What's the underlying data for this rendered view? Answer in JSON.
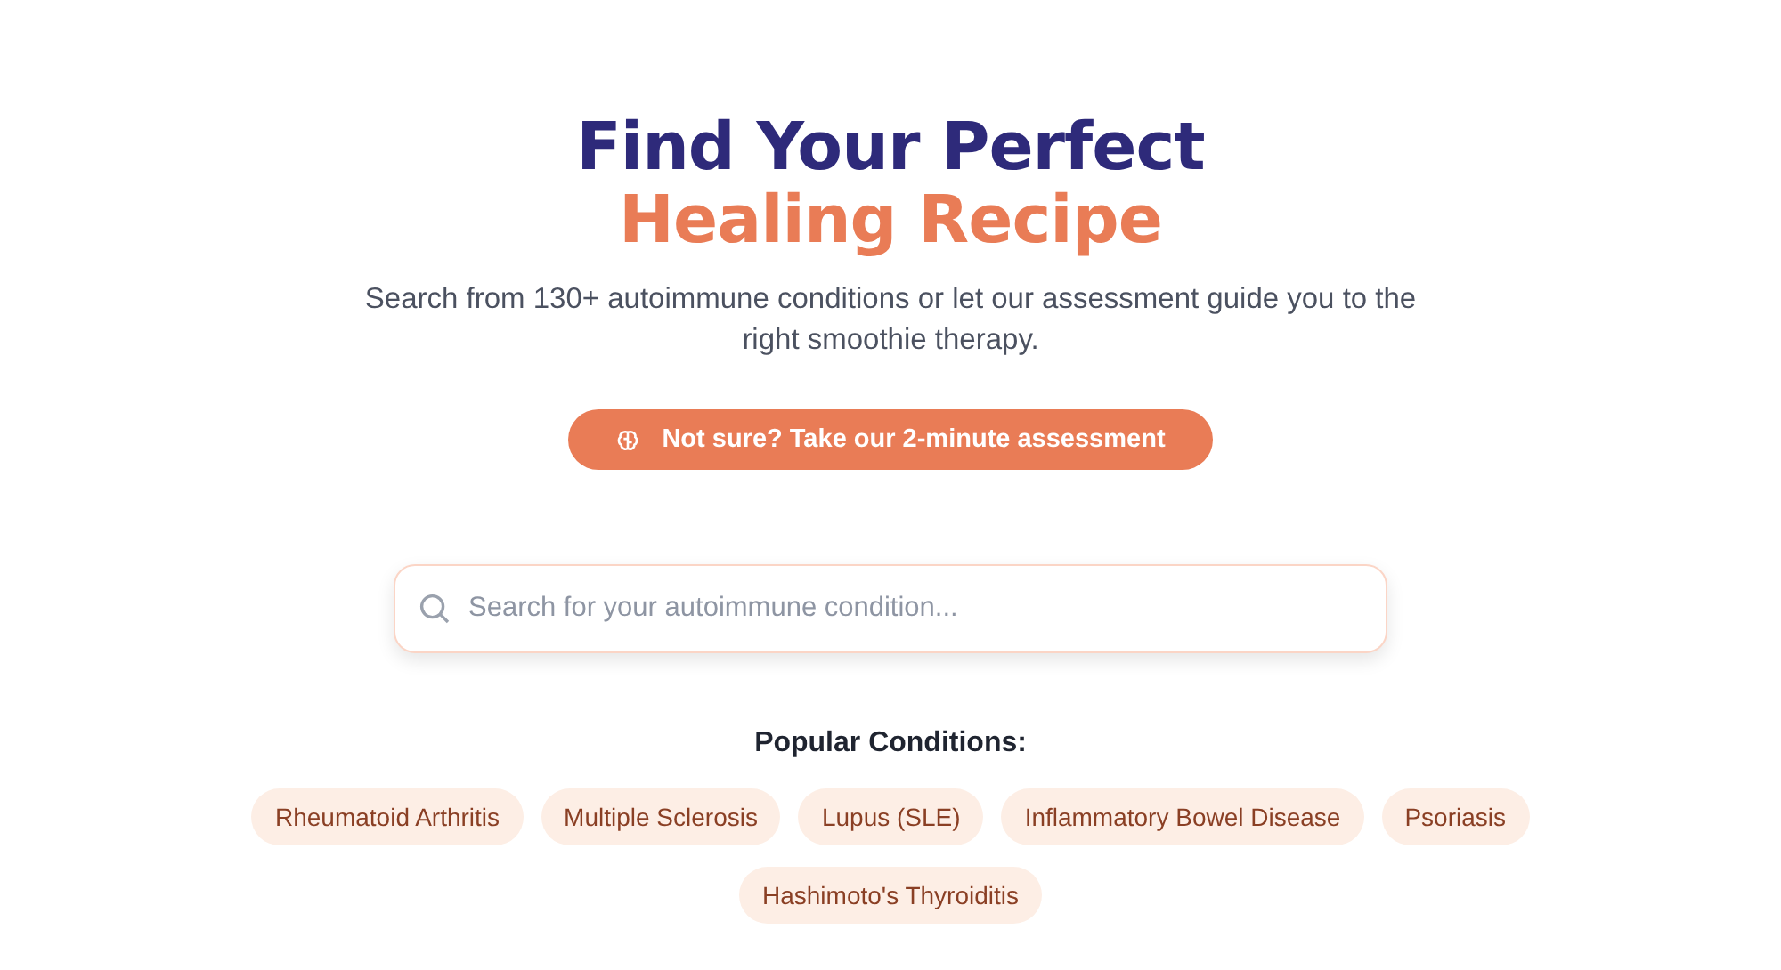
{
  "heading": {
    "line_1": "Find Your Perfect",
    "line_2": "Healing Recipe"
  },
  "subtitle": "Search from 130+ autoimmune conditions or let our assessment guide you to the right smoothie therapy.",
  "assessment_button": {
    "label": "Not sure? Take our 2-minute assessment"
  },
  "search": {
    "placeholder": "Search for your autoimmune condition..."
  },
  "popular": {
    "title": "Popular Conditions:",
    "conditions": [
      "Rheumatoid Arthritis",
      "Multiple Sclerosis",
      "Lupus (SLE)",
      "Inflammatory Bowel Disease",
      "Psoriasis",
      "Hashimoto's Thyroiditis"
    ]
  }
}
